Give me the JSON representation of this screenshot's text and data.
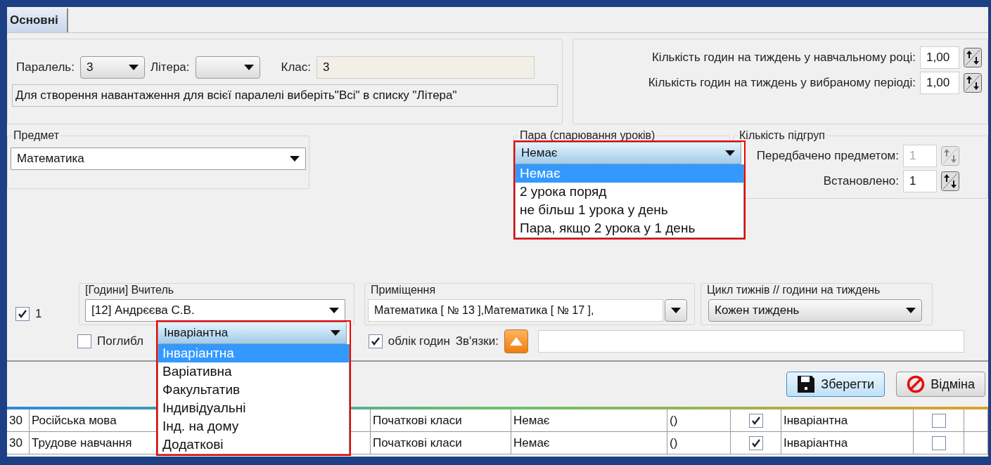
{
  "tabs": [
    {
      "label": "Основні",
      "selected": true
    }
  ],
  "class_group": {
    "parallel_label": "Паралель:",
    "parallel_value": "3",
    "letter_label": "Літера:",
    "class_label": "Клас:",
    "class_value": "3",
    "hint": "Для створення навантаження для всієї паралелі виберіть\"Всі\" в списку \"Літера\""
  },
  "hours_group": {
    "rows": [
      {
        "label": "Кількість годин на тиждень у навчальному році:",
        "value": "1,00"
      },
      {
        "label": "Кількість годин  на тиждень у вибраному періоді:",
        "value": "1,00"
      }
    ]
  },
  "subject": {
    "legend": "Предмет",
    "value": "Математика"
  },
  "pair": {
    "legend": "Пара (спарювання уроків)",
    "value": "Немає",
    "expanded": true,
    "options": [
      {
        "label": "Немає",
        "selected": true
      },
      {
        "label": "2 урока поряд",
        "selected": false
      },
      {
        "label": "не більш 1 урока у день",
        "selected": false
      },
      {
        "label": "Пара, якщо 2 урока у 1 день",
        "selected": false
      }
    ]
  },
  "subgroups": {
    "legend": "Кількість підгруп",
    "rows": [
      {
        "label": "Передбачено предметом:",
        "value": "1",
        "disabled": true
      },
      {
        "label": "Встановлено:",
        "value": "1",
        "disabled": false
      }
    ]
  },
  "teacher_row": {
    "checked": true,
    "number": "1",
    "teacher_legend": "[Години] Вчитель",
    "teacher_value": "[12] Андрєєва С.В.",
    "room_legend": "Приміщення",
    "room_value": "Математика [ № 13 ],Математика [ № 17 ],",
    "cycle_legend": "Цикл тижнів // години на тиждень",
    "cycle_value": "Кожен тиждень",
    "deep_checked": false,
    "deep_label": "Поглибл",
    "accounting_checked": true,
    "accounting_label": "облік годин",
    "links_label": "Зв'язки:"
  },
  "type_dropdown": {
    "value": "Інваріантна",
    "expanded": true,
    "options": [
      {
        "label": "Інваріантна",
        "selected": true
      },
      {
        "label": "Варіативна",
        "selected": false
      },
      {
        "label": "Факультатив",
        "selected": false
      },
      {
        "label": "Індивідуальні",
        "selected": false
      },
      {
        "label": "Інд. на дому",
        "selected": false
      },
      {
        "label": "Додаткові",
        "selected": false
      }
    ]
  },
  "buttons": [
    {
      "label": "Зберегти",
      "kind": "save"
    },
    {
      "label": "Відміна",
      "kind": "cancel"
    }
  ],
  "table": {
    "rows": [
      {
        "column_1": "30",
        "subject": "Російська мова",
        "department": "Початкові класи",
        "pair": "Немає",
        "rooms": "()",
        "accounting": true,
        "type": "Інваріантна",
        "deep": false
      },
      {
        "column_1": "30",
        "subject": "Трудове навчання",
        "department": "Початкові класи",
        "pair": "Немає",
        "rooms": "()",
        "accounting": true,
        "type": "Інваріантна",
        "deep": false
      }
    ]
  }
}
